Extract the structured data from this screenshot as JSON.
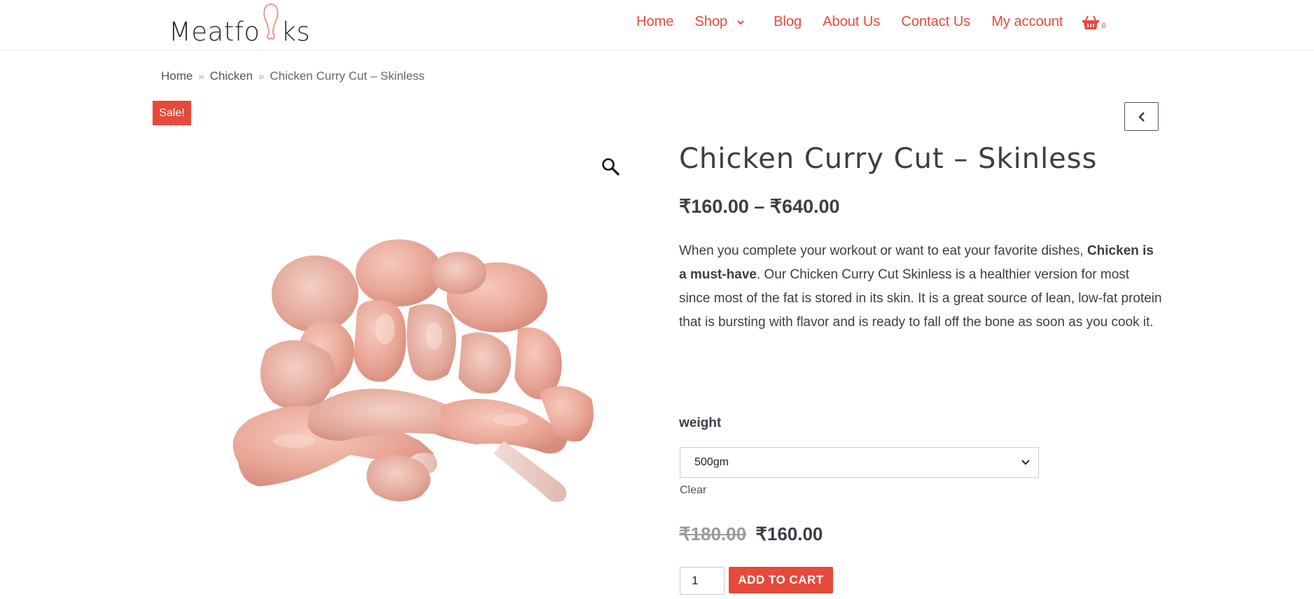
{
  "header": {
    "logo_text": "Meatfolks",
    "nav": [
      {
        "label": "Home"
      },
      {
        "label": "Shop"
      },
      {
        "label": "Blog"
      },
      {
        "label": "About Us"
      },
      {
        "label": "Contact Us"
      },
      {
        "label": "My account"
      }
    ],
    "cart_count": "0"
  },
  "breadcrumb": {
    "items": [
      "Home",
      "Chicken",
      "Chicken Curry Cut – Skinless"
    ],
    "separator": "»"
  },
  "product": {
    "badge": "Sale!",
    "title": "Chicken Curry Cut – Skinless",
    "price_range": "₹160.00 – ₹640.00",
    "description": {
      "part1": "When you complete your workout or want to eat your favorite dishes, ",
      "bold": "Chicken is a must-have",
      "part2": ". Our Chicken Curry Cut Skinless is a healthier version for most since most of the fat is stored in its skin. It is a great source of lean, low-fat protein that is bursting with flavor and is ready to fall off the bone as soon as you cook it."
    },
    "weight_label": "weight",
    "weight_selected": "500gm",
    "clear_label": "Clear",
    "old_price": "₹180.00",
    "sale_price": "₹160.00",
    "quantity": "1",
    "add_to_cart_label": "ADD TO CART"
  },
  "colors": {
    "accent": "#e64a3b",
    "text": "#3b3e46"
  },
  "icons": [
    "drumstick-logo-icon",
    "chevron-down-icon",
    "basket-icon",
    "chevron-left-icon",
    "magnifier-icon"
  ]
}
